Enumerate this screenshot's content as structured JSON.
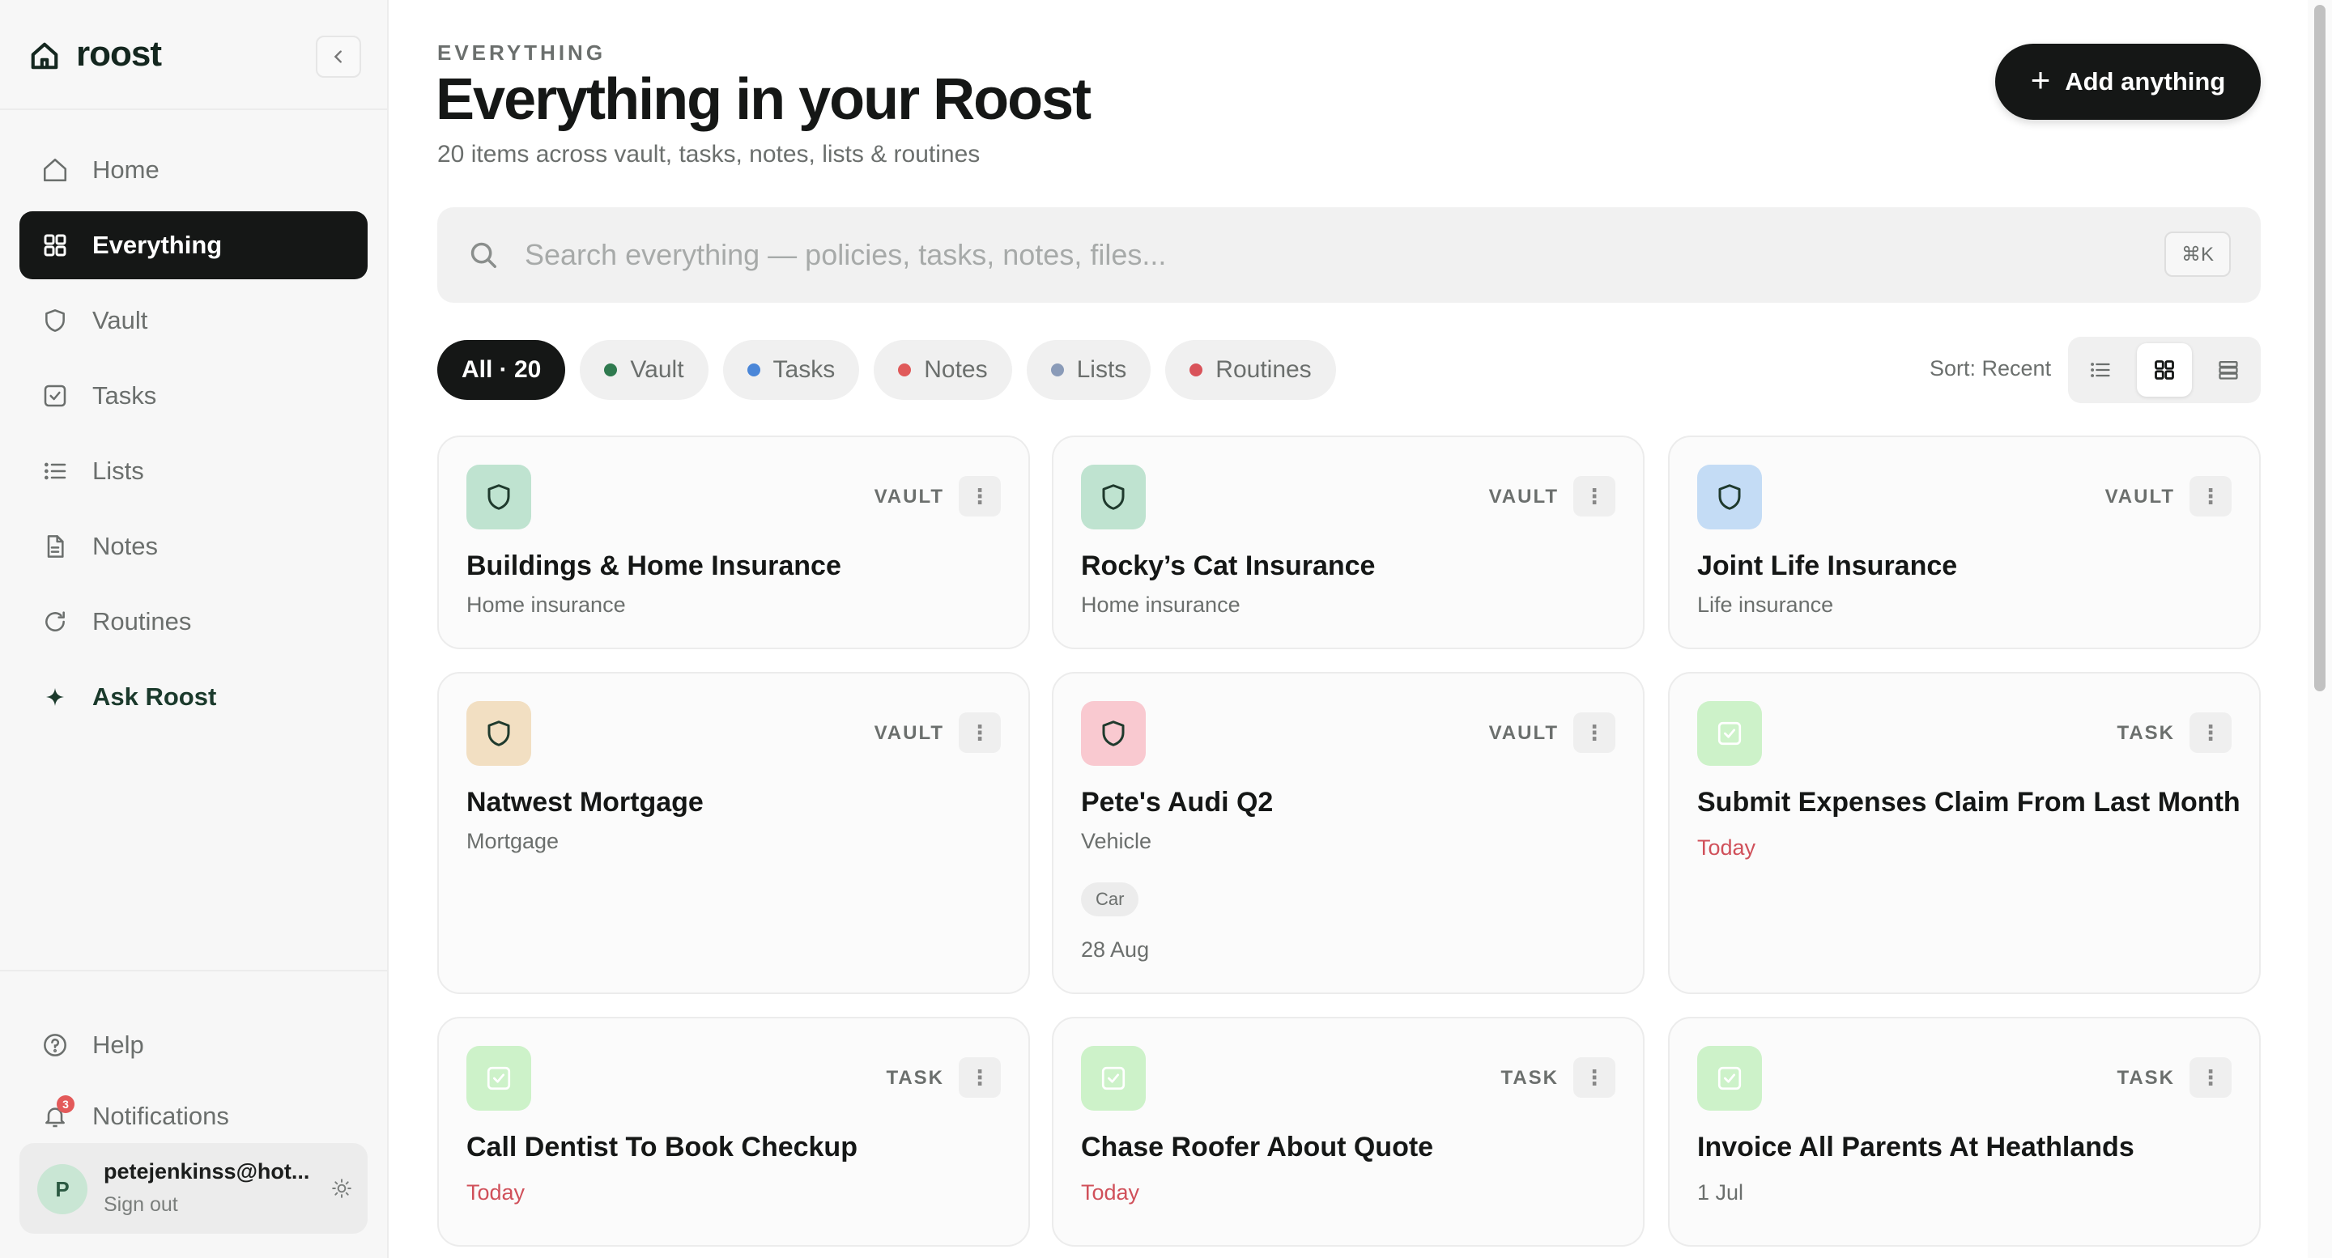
{
  "brand": {
    "name": "roost"
  },
  "nav": [
    {
      "label": "Home",
      "icon": "home-icon"
    },
    {
      "label": "Everything",
      "icon": "grid-icon",
      "active": true
    },
    {
      "label": "Vault",
      "icon": "shield-icon"
    },
    {
      "label": "Tasks",
      "icon": "check-square-icon"
    },
    {
      "label": "Lists",
      "icon": "list-icon"
    },
    {
      "label": "Notes",
      "icon": "document-icon"
    },
    {
      "label": "Routines",
      "icon": "refresh-icon"
    },
    {
      "label": "Ask Roost",
      "icon": "sparkle-icon"
    }
  ],
  "sidebar_bottom": {
    "help": "Help",
    "notifications": "Notifications",
    "notification_count": "3",
    "user": {
      "initial": "P",
      "email": "petejenkinss@hot...",
      "signout": "Sign out"
    }
  },
  "header": {
    "eyebrow": "EVERYTHING",
    "title": "Everything in your Roost",
    "subtitle": "20 items across vault, tasks, notes, lists & routines",
    "add_label": "Add anything"
  },
  "search": {
    "placeholder": "Search everything — policies, tasks, notes, files...",
    "shortcut": "⌘K"
  },
  "filters": [
    {
      "label": "All · 20",
      "active": true
    },
    {
      "label": "Vault",
      "color": "#2f7a4f"
    },
    {
      "label": "Tasks",
      "color": "#4a86d8"
    },
    {
      "label": "Notes",
      "color": "#e05a5a"
    },
    {
      "label": "Lists",
      "color": "#8a9bb8"
    },
    {
      "label": "Routines",
      "color": "#d9535a"
    }
  ],
  "sort": {
    "label": "Sort: Recent"
  },
  "cards": [
    {
      "type": "VAULT",
      "title": "Buildings & Home Insurance",
      "subtitle": "Home insurance",
      "icon_bg": "#bfe3d0"
    },
    {
      "type": "VAULT",
      "title": "Rocky’s Cat Insurance",
      "subtitle": "Home insurance",
      "icon_bg": "#bfe3d0"
    },
    {
      "type": "VAULT",
      "title": "Joint Life Insurance",
      "subtitle": "Life insurance",
      "icon_bg": "#c4dcf5"
    },
    {
      "type": "VAULT",
      "title": "Natwest Mortgage",
      "subtitle": "Mortgage",
      "icon_bg": "#f2dfc2"
    },
    {
      "type": "VAULT",
      "title": "Pete's Audi Q2",
      "subtitle": "Vehicle",
      "tag": "Car",
      "date": "28 Aug",
      "icon_bg": "#f9c9d0"
    },
    {
      "type": "TASK",
      "title": "Submit Expenses Claim From Last Month",
      "due": "Today",
      "icon_bg": "#cdf2c9"
    },
    {
      "type": "TASK",
      "title": "Call Dentist To Book Checkup",
      "due": "Today",
      "icon_bg": "#cdf2c9"
    },
    {
      "type": "TASK",
      "title": "Chase Roofer About Quote",
      "due": "Today",
      "icon_bg": "#cdf2c9"
    },
    {
      "type": "TASK",
      "title": "Invoice All Parents At Heathlands",
      "due": "1 Jul",
      "icon_bg": "#cdf2c9"
    }
  ],
  "colors": {
    "accent_dark": "#151716",
    "due_red": "#d0505a",
    "brand_green": "#14271f"
  }
}
